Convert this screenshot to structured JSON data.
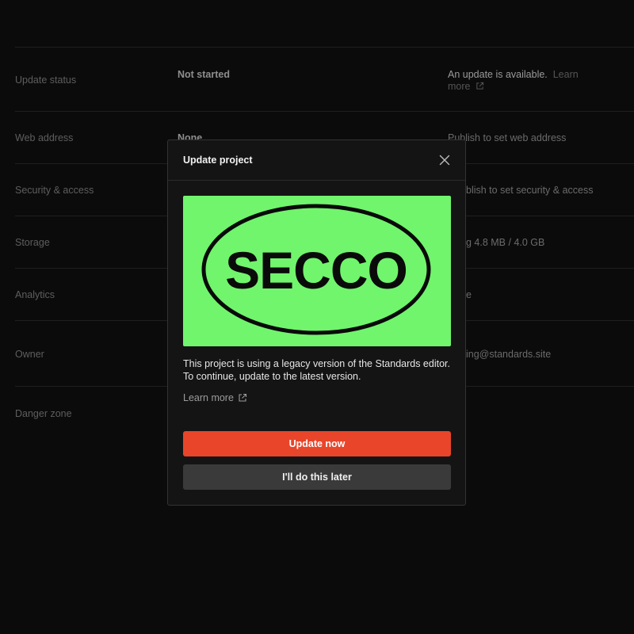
{
  "settings": {
    "rows": [
      {
        "label": "Update status",
        "value": "Not started",
        "aside_main": "An update is available.",
        "aside_link": "Learn",
        "aside_link2": "more"
      },
      {
        "label": "Web address",
        "value": "None",
        "aside": "Publish to set web address"
      },
      {
        "label": "Security & access",
        "aside": "blish to set security & access"
      },
      {
        "label": "Storage",
        "aside": "g 4.8 MB / 4.0 GB"
      },
      {
        "label": "Analytics",
        "aside": "e"
      },
      {
        "label": "Owner",
        "aside": "ing@standards.site"
      },
      {
        "label": "Danger zone"
      }
    ]
  },
  "modal": {
    "title": "Update project",
    "hero_text": "SECCO",
    "body": "This project is using a legacy version of the Standards editor. To continue, update to the latest version.",
    "learn_more": "Learn more",
    "primary_button": "Update now",
    "secondary_button": "I'll do this later"
  },
  "colors": {
    "accent": "#e9452a",
    "hero_background": "#70f56c",
    "modal_background": "#141414",
    "page_background": "#0b0b0b"
  },
  "icons": [
    "close-icon",
    "external-link-icon"
  ]
}
